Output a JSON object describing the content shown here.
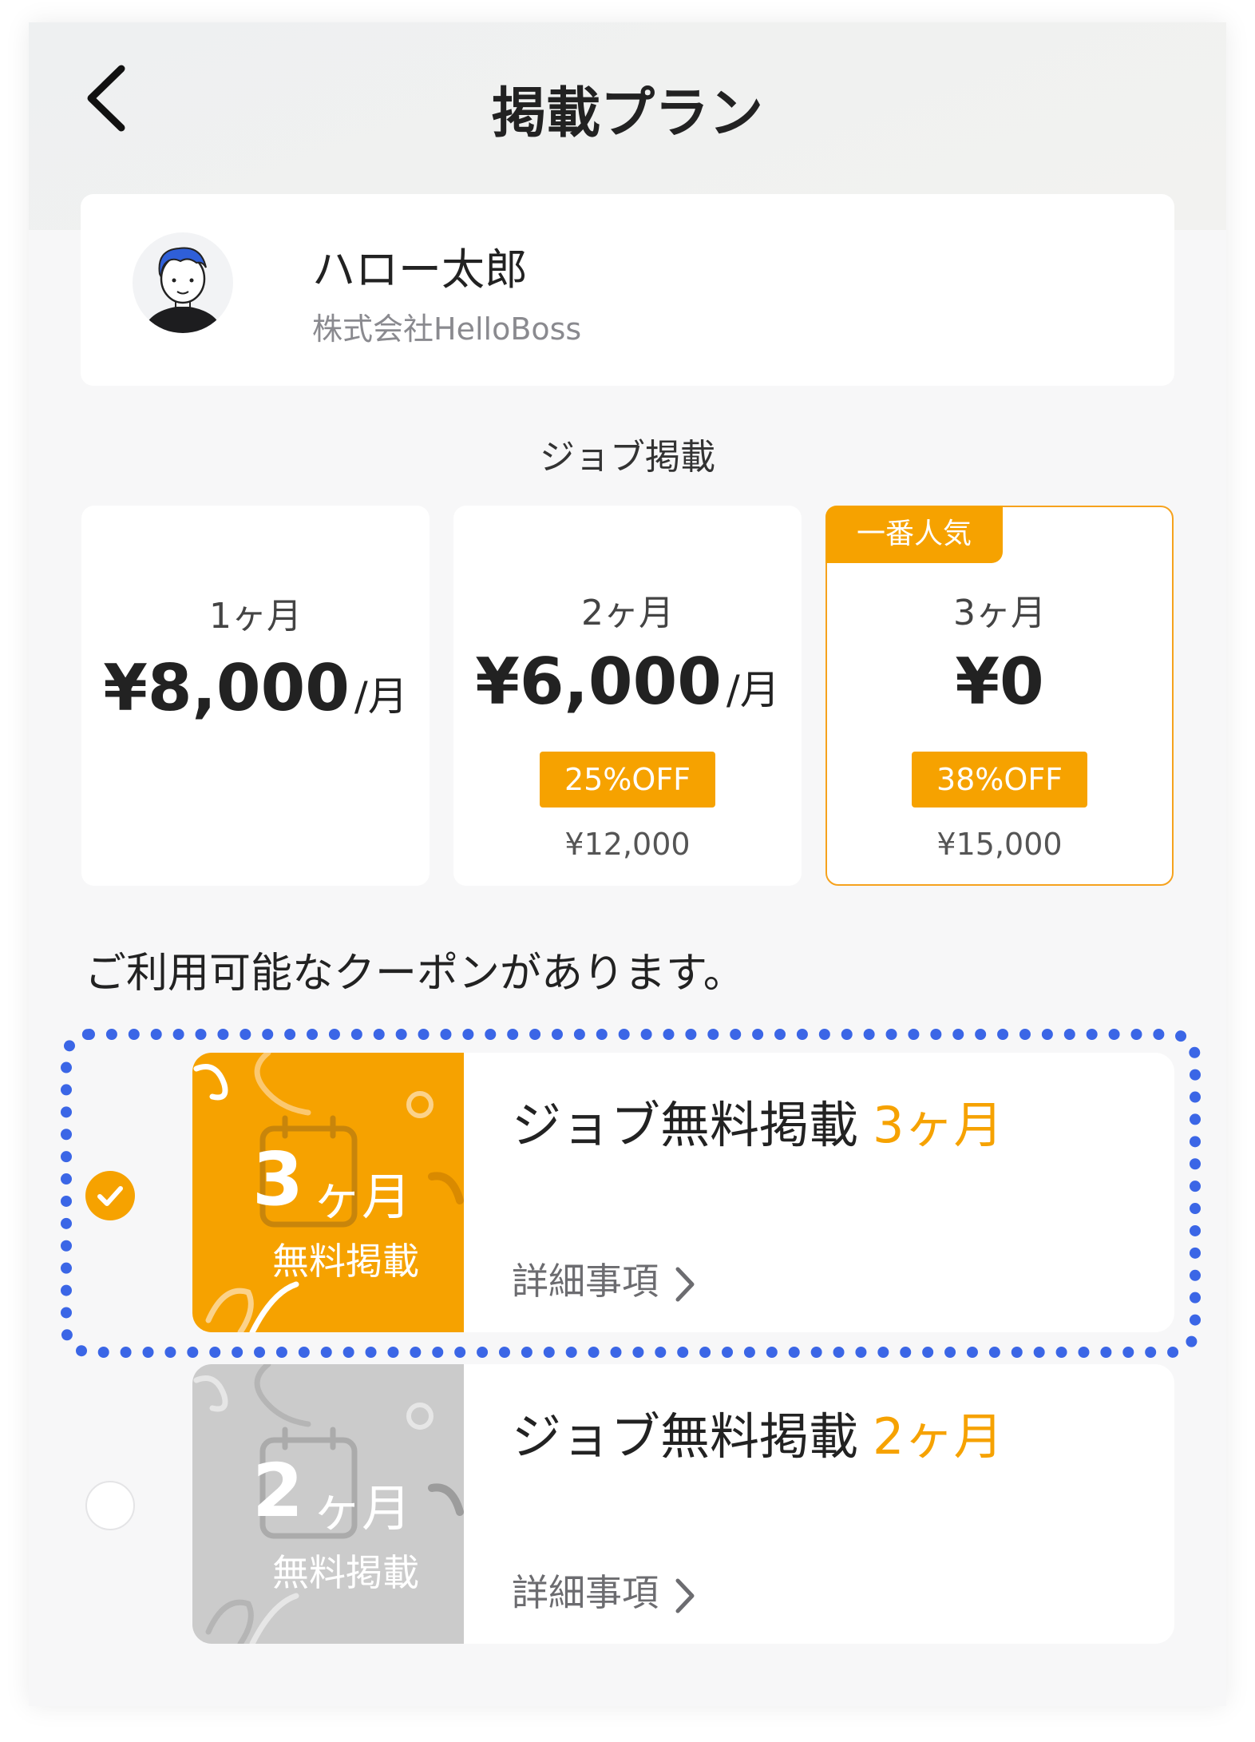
{
  "header": {
    "title": "掲載プラン",
    "back_icon": "chevron-left-icon"
  },
  "user": {
    "name": "ハロー太郎",
    "company": "株式会社HelloBoss",
    "avatar_icon": "user-avatar-icon"
  },
  "section_label": "ジョブ掲載",
  "plans": [
    {
      "months": "1ヶ月",
      "price": "¥8,000",
      "unit": "/月",
      "discount": "",
      "original": "",
      "badge": "",
      "selected": false
    },
    {
      "months": "2ヶ月",
      "price": "¥6,000",
      "unit": "/月",
      "discount": "25%OFF",
      "original": "¥12,000",
      "badge": "",
      "selected": false
    },
    {
      "months": "3ヶ月",
      "price": "¥0",
      "unit": "",
      "discount": "38%OFF",
      "original": "¥15,000",
      "badge": "一番人気",
      "selected": true
    }
  ],
  "coupon_label": "ご利用可能なクーポンがあります。",
  "coupons": [
    {
      "art_number": "3",
      "art_unit": "ヶ月",
      "art_sub": "無料掲載",
      "title": "ジョブ無料掲載",
      "title_accent": "3ヶ月",
      "details": "詳細事項",
      "selected": true
    },
    {
      "art_number": "2",
      "art_unit": "ヶ月",
      "art_sub": "無料掲載",
      "title": "ジョブ無料掲載",
      "title_accent": "2ヶ月",
      "details": "詳細事項",
      "selected": false
    }
  ],
  "colors": {
    "accent": "#f6a200",
    "focus_ring": "#3b66e6",
    "disabled_art": "#cbcbcb"
  }
}
